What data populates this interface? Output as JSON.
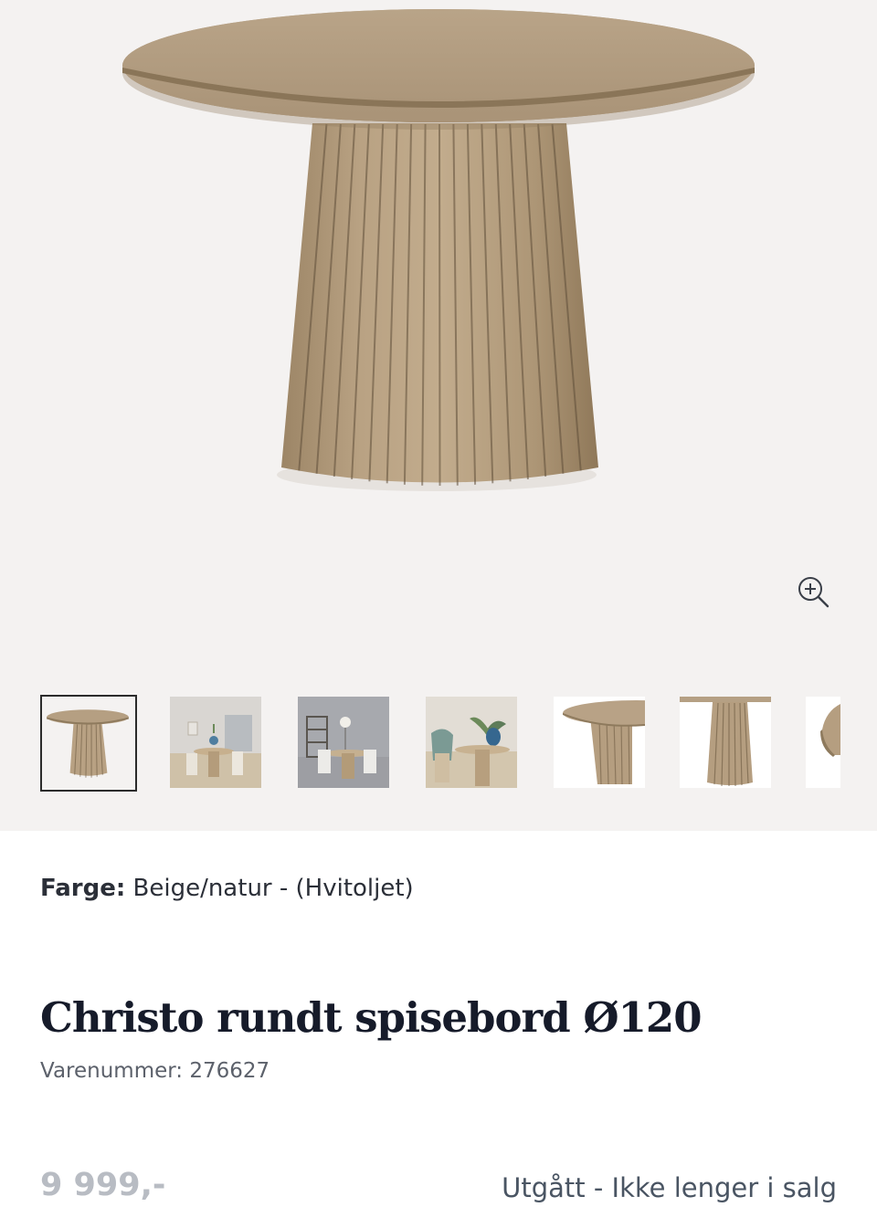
{
  "product": {
    "color_label": "Farge:",
    "color_value": "Beige/natur - (Hvitoljet)",
    "title": "Christo rundt spisebord Ø120",
    "sku_label": "Varenummer:",
    "sku_value": "276627",
    "price": "9 999,-",
    "status": "Utgått - Ikke lenger i salg"
  },
  "gallery": {
    "zoom_icon": "zoom-in-icon",
    "thumbnails": [
      {
        "name": "table-front",
        "selected": true
      },
      {
        "name": "dining-room-scene-1",
        "selected": false
      },
      {
        "name": "dining-room-scene-2",
        "selected": false
      },
      {
        "name": "dining-room-scene-3",
        "selected": false
      },
      {
        "name": "tabletop-closeup",
        "selected": false
      },
      {
        "name": "pedestal-closeup",
        "selected": false
      },
      {
        "name": "edge-closeup",
        "selected": false
      }
    ]
  },
  "colors": {
    "wood": "#b59e80",
    "background": "#f4f2f1",
    "text_dark": "#161b2a"
  }
}
